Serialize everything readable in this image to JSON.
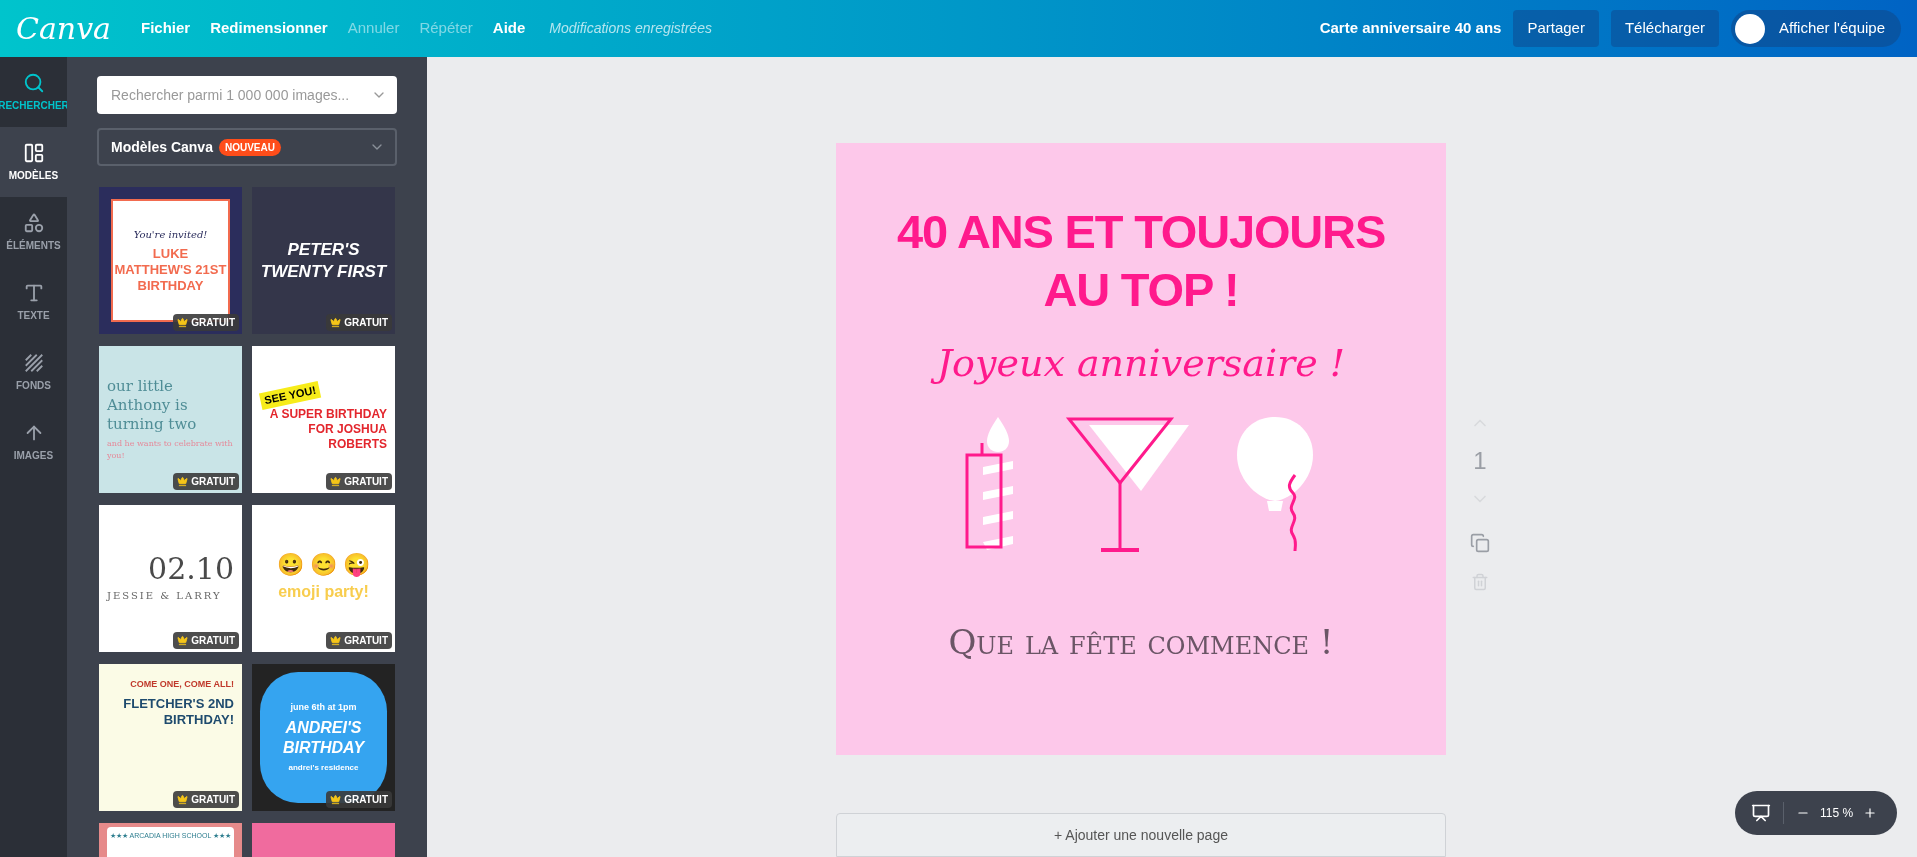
{
  "topbar": {
    "logo": "Canva",
    "menu": [
      {
        "label": "Fichier",
        "disabled": false
      },
      {
        "label": "Redimensionner",
        "disabled": false
      },
      {
        "label": "Annuler",
        "disabled": true
      },
      {
        "label": "Répéter",
        "disabled": true
      },
      {
        "label": "Aide",
        "disabled": false
      }
    ],
    "save_status": "Modifications enregistrées",
    "design_title": "Carte anniversaire 40 ans",
    "buttons": [
      "Partager",
      "Télécharger"
    ],
    "team_toggle": {
      "label": "Afficher l'équipe",
      "on": false
    }
  },
  "sidebar": {
    "items": [
      {
        "label": "RECHERCHER",
        "kind": "search",
        "selected": false,
        "active": true
      },
      {
        "label": "MODÈLES",
        "kind": "templates",
        "selected": true,
        "active": false
      },
      {
        "label": "ÉLÉMENTS",
        "kind": "elements",
        "selected": false,
        "active": false
      },
      {
        "label": "TEXTE",
        "kind": "text",
        "selected": false,
        "active": false
      },
      {
        "label": "FONDS",
        "kind": "backgrounds",
        "selected": false,
        "active": false
      },
      {
        "label": "IMAGES",
        "kind": "uploads",
        "selected": false,
        "active": false
      }
    ]
  },
  "panel": {
    "search": {
      "placeholder": "Rechercher parmi 1 000 000 images..."
    },
    "source": {
      "label": "Modèles Canva",
      "badge": "NOUVEAU"
    },
    "templates": [
      {
        "kind": "navy-invite",
        "eyebrow": "You're invited!",
        "title": "LUKE MATTHEW'S 21ST BIRTHDAY",
        "badge": "GRATUIT"
      },
      {
        "kind": "dark-confetti",
        "title": "PETER'S TWENTY FIRST",
        "badge": "GRATUIT"
      },
      {
        "kind": "pastel-bunting",
        "title": "our little Anthony is turning two",
        "subtitle": "and he wants to celebrate with you!",
        "badge": "GRATUIT"
      },
      {
        "kind": "comic",
        "eyebrow": "SEE YOU!",
        "title": "A SUPER BIRTHDAY FOR JOSHUA ROBERTS",
        "badge": "GRATUIT"
      },
      {
        "kind": "minimal",
        "eyebrow": "02.10",
        "title": "JESSIE & LARRY",
        "badge": "GRATUIT"
      },
      {
        "kind": "emoji",
        "eyebrow": "😀 😊 😜",
        "title": "emoji party!",
        "badge": "GRATUIT"
      },
      {
        "kind": "circus",
        "eyebrow": "COME ONE, COME ALL!",
        "title": "FLETCHER'S 2ND BIRTHDAY!",
        "badge": "GRATUIT"
      },
      {
        "kind": "burst",
        "eyebrow": "june 6th at 1pm",
        "title": "ANDREI'S BIRTHDAY",
        "subtitle": "andrei's residence",
        "badge": "GRATUIT"
      },
      {
        "kind": "banner",
        "title": "★★★ ARCADIA HIGH SCHOOL ★★★"
      },
      {
        "kind": "chevron"
      }
    ]
  },
  "canvas": {
    "page": {
      "headline": "40 ANS ET TOUJOURS AU TOP !",
      "greeting": "Joyeux anniversaire !",
      "footer": "Que la fête commence !"
    },
    "page_number": "1",
    "add_page": "+ Ajouter une nouvelle page",
    "zoom": "115 %"
  }
}
